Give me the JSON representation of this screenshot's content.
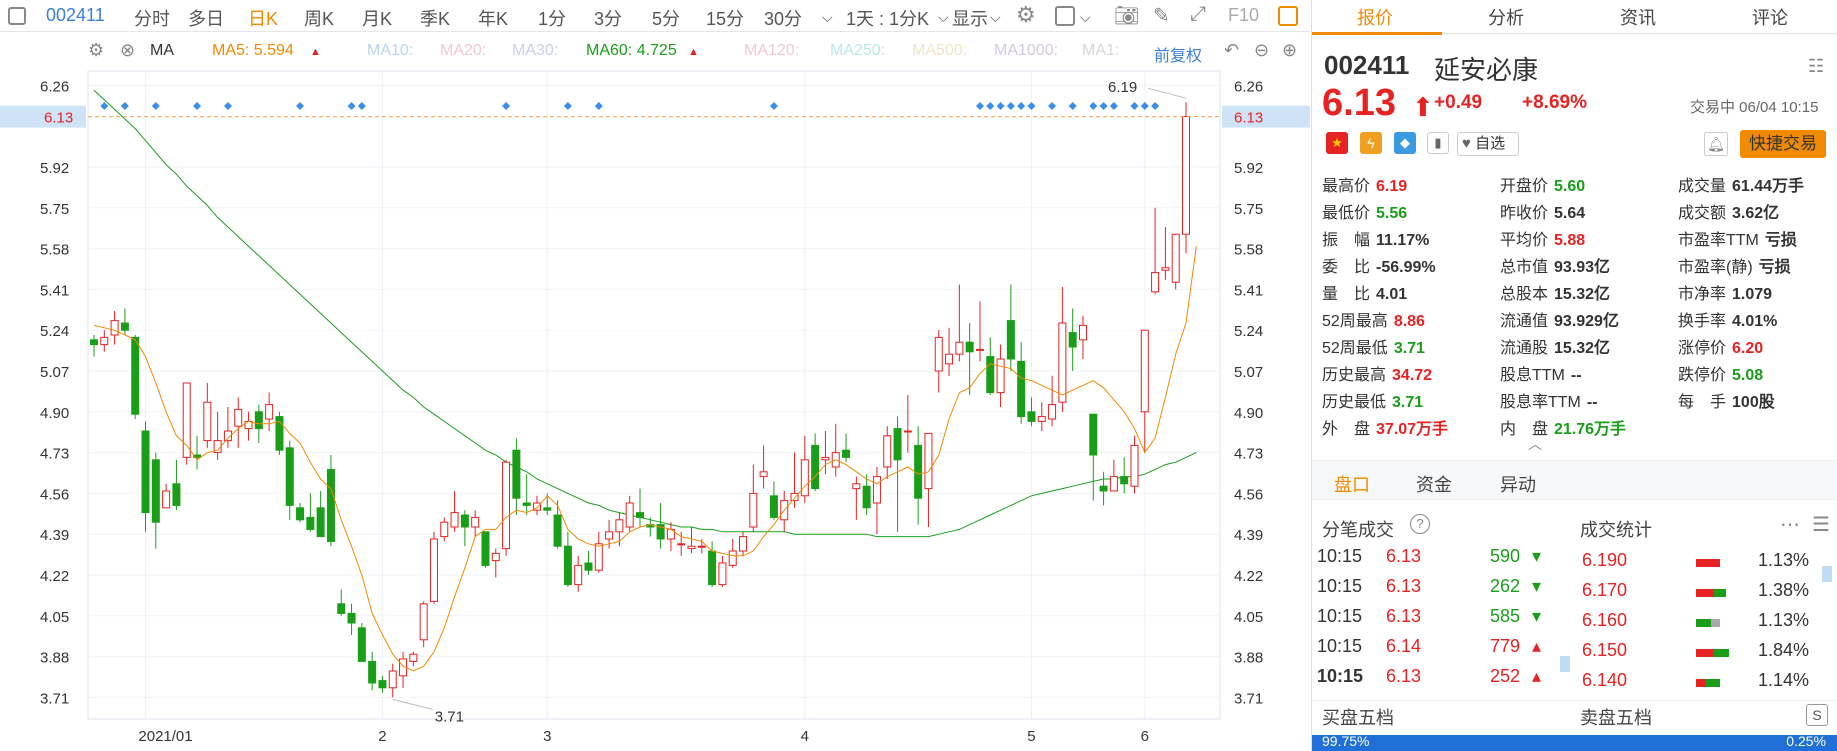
{
  "toolbar": {
    "code": "002411",
    "periods": [
      "分时",
      "多日",
      "日K",
      "周K",
      "月K",
      "季K",
      "年K",
      "1分",
      "3分",
      "5分",
      "15分",
      "30分"
    ],
    "active_period": "日K",
    "interval_select": "1天 : 1分K",
    "display_label": "显示",
    "f10_label": "F10"
  },
  "ma_bar": {
    "type_label": "MA",
    "ma5": "MA5: 5.594",
    "ma10": "MA10:",
    "ma20": "MA20:",
    "ma30": "MA30:",
    "ma60": "MA60: 4.725",
    "ma120": "MA120:",
    "ma250": "MA250:",
    "ma500": "MA500:",
    "ma1000": "MA1000:",
    "ma1": "MA1:",
    "adjust": "前复权"
  },
  "chart_data": {
    "type": "candlestick",
    "ylim": [
      3.62,
      6.32
    ],
    "yticks": [
      3.71,
      3.88,
      4.05,
      4.22,
      4.39,
      4.56,
      4.73,
      4.9,
      5.07,
      5.24,
      5.41,
      5.58,
      5.75,
      5.92,
      6.26
    ],
    "current_price_label": "6.13",
    "current_price": 6.13,
    "high_label": "6.19",
    "low_label": "3.71",
    "xlabels": [
      "2021/01",
      "2",
      "3",
      "4",
      "5",
      "6"
    ],
    "candles": [
      [
        5.2,
        5.22,
        5.13,
        5.18
      ],
      [
        5.18,
        5.24,
        5.15,
        5.21
      ],
      [
        5.22,
        5.32,
        5.18,
        5.28
      ],
      [
        5.27,
        5.33,
        5.22,
        5.24
      ],
      [
        5.21,
        5.22,
        4.87,
        4.89
      ],
      [
        4.82,
        4.86,
        4.4,
        4.48
      ],
      [
        4.7,
        4.73,
        4.33,
        4.44
      ],
      [
        4.5,
        4.6,
        4.5,
        4.57
      ],
      [
        4.6,
        4.7,
        4.49,
        4.51
      ],
      [
        4.71,
        5.02,
        4.68,
        5.02
      ],
      [
        4.72,
        4.8,
        4.66,
        4.71
      ],
      [
        4.78,
        5.02,
        4.75,
        4.94
      ],
      [
        4.73,
        4.9,
        4.7,
        4.78
      ],
      [
        4.78,
        4.92,
        4.75,
        4.82
      ],
      [
        4.84,
        4.96,
        4.75,
        4.91
      ],
      [
        4.83,
        4.9,
        4.78,
        4.86
      ],
      [
        4.9,
        4.93,
        4.77,
        4.83
      ],
      [
        4.87,
        4.98,
        4.82,
        4.93
      ],
      [
        4.88,
        4.9,
        4.72,
        4.74
      ],
      [
        4.75,
        4.78,
        4.45,
        4.51
      ],
      [
        4.5,
        4.52,
        4.44,
        4.45
      ],
      [
        4.46,
        4.56,
        4.4,
        4.41
      ],
      [
        4.5,
        4.57,
        4.38,
        4.38
      ],
      [
        4.66,
        4.72,
        4.34,
        4.36
      ],
      [
        4.1,
        4.16,
        4.05,
        4.06
      ],
      [
        4.06,
        4.1,
        3.97,
        4.02
      ],
      [
        4.0,
        4.02,
        3.86,
        3.86
      ],
      [
        3.86,
        3.9,
        3.74,
        3.77
      ],
      [
        3.78,
        3.8,
        3.73,
        3.75
      ],
      [
        3.75,
        3.85,
        3.71,
        3.82
      ],
      [
        3.8,
        3.9,
        3.75,
        3.87
      ],
      [
        3.86,
        3.9,
        3.84,
        3.89
      ],
      [
        3.95,
        4.11,
        3.92,
        4.1
      ],
      [
        4.11,
        4.4,
        4.1,
        4.37
      ],
      [
        4.38,
        4.46,
        4.36,
        4.44
      ],
      [
        4.42,
        4.57,
        4.4,
        4.48
      ],
      [
        4.47,
        4.49,
        4.34,
        4.42
      ],
      [
        4.42,
        4.49,
        4.38,
        4.46
      ],
      [
        4.4,
        4.4,
        4.25,
        4.26
      ],
      [
        4.28,
        4.33,
        4.21,
        4.31
      ],
      [
        4.33,
        4.7,
        4.3,
        4.69
      ],
      [
        4.74,
        4.79,
        4.47,
        4.54
      ],
      [
        4.52,
        4.64,
        4.47,
        4.51
      ],
      [
        4.49,
        4.55,
        4.47,
        4.52
      ],
      [
        4.5,
        4.56,
        4.47,
        4.49
      ],
      [
        4.47,
        4.53,
        4.33,
        4.34
      ],
      [
        4.34,
        4.4,
        4.17,
        4.18
      ],
      [
        4.18,
        4.3,
        4.15,
        4.26
      ],
      [
        4.27,
        4.32,
        4.22,
        4.24
      ],
      [
        4.24,
        4.4,
        4.23,
        4.35
      ],
      [
        4.37,
        4.45,
        4.33,
        4.4
      ],
      [
        4.4,
        4.48,
        4.34,
        4.45
      ],
      [
        4.42,
        4.55,
        4.4,
        4.52
      ],
      [
        4.48,
        4.58,
        4.42,
        4.46
      ],
      [
        4.43,
        4.46,
        4.38,
        4.42
      ],
      [
        4.43,
        4.52,
        4.33,
        4.37
      ],
      [
        4.37,
        4.44,
        4.32,
        4.41
      ],
      [
        4.35,
        4.4,
        4.3,
        4.35
      ],
      [
        4.33,
        4.42,
        4.31,
        4.34
      ],
      [
        4.34,
        4.37,
        4.31,
        4.34
      ],
      [
        4.32,
        4.36,
        4.17,
        4.18
      ],
      [
        4.18,
        4.3,
        4.17,
        4.27
      ],
      [
        4.26,
        4.37,
        4.25,
        4.32
      ],
      [
        4.32,
        4.4,
        4.3,
        4.38
      ],
      [
        4.42,
        4.68,
        4.4,
        4.56
      ],
      [
        4.63,
        4.76,
        4.58,
        4.65
      ],
      [
        4.55,
        4.61,
        4.45,
        4.46
      ],
      [
        4.45,
        4.57,
        4.4,
        4.53
      ],
      [
        4.53,
        4.73,
        4.5,
        4.56
      ],
      [
        4.55,
        4.8,
        4.52,
        4.7
      ],
      [
        4.76,
        4.81,
        4.57,
        4.58
      ],
      [
        4.7,
        4.82,
        4.64,
        4.71
      ],
      [
        4.67,
        4.85,
        4.63,
        4.73
      ],
      [
        4.74,
        4.81,
        4.69,
        4.71
      ],
      [
        4.58,
        4.63,
        4.45,
        4.6
      ],
      [
        4.59,
        4.64,
        4.47,
        4.5
      ],
      [
        4.52,
        4.67,
        4.39,
        4.63
      ],
      [
        4.67,
        4.84,
        4.62,
        4.8
      ],
      [
        4.83,
        4.88,
        4.4,
        4.7
      ],
      [
        4.82,
        4.97,
        4.73,
        4.82
      ],
      [
        4.76,
        4.84,
        4.43,
        4.54
      ],
      [
        4.58,
        4.81,
        4.42,
        4.81
      ],
      [
        5.07,
        5.24,
        4.98,
        5.21
      ],
      [
        5.1,
        5.25,
        5.05,
        5.14
      ],
      [
        5.14,
        5.43,
        5.11,
        5.19
      ],
      [
        5.19,
        5.27,
        4.97,
        5.15
      ],
      [
        5.16,
        5.36,
        5.11,
        5.16
      ],
      [
        5.13,
        5.21,
        4.97,
        4.98
      ],
      [
        4.98,
        5.18,
        4.92,
        5.12
      ],
      [
        5.28,
        5.43,
        5.07,
        5.12
      ],
      [
        5.11,
        5.19,
        4.85,
        4.88
      ],
      [
        4.9,
        4.96,
        4.84,
        4.86
      ],
      [
        4.86,
        4.94,
        4.82,
        4.88
      ],
      [
        4.87,
        5.05,
        4.84,
        4.93
      ],
      [
        4.94,
        5.42,
        4.9,
        5.27
      ],
      [
        5.23,
        5.33,
        5.07,
        5.17
      ],
      [
        5.2,
        5.3,
        5.12,
        5.26
      ],
      [
        4.89,
        4.89,
        4.53,
        4.72
      ],
      [
        4.59,
        4.65,
        4.51,
        4.57
      ],
      [
        4.57,
        4.7,
        4.57,
        4.63
      ],
      [
        4.63,
        4.71,
        4.56,
        4.6
      ],
      [
        4.59,
        4.8,
        4.56,
        4.76
      ],
      [
        4.9,
        5.24,
        4.73,
        5.24
      ],
      [
        5.4,
        5.75,
        5.39,
        5.48
      ],
      [
        5.49,
        5.67,
        5.45,
        5.5
      ],
      [
        5.44,
        5.64,
        5.41,
        5.64
      ],
      [
        5.64,
        6.19,
        5.56,
        6.13
      ]
    ],
    "ma5": [
      5.26,
      5.25,
      5.24,
      5.22,
      5.2,
      5.13,
      5.02,
      4.9,
      4.8,
      4.76,
      4.7,
      4.73,
      4.74,
      4.79,
      4.83,
      4.86,
      4.85,
      4.85,
      4.86,
      4.81,
      4.77,
      4.69,
      4.62,
      4.58,
      4.45,
      4.34,
      4.22,
      4.06,
      3.97,
      3.89,
      3.84,
      3.82,
      3.84,
      3.9,
      4.0,
      4.13,
      4.25,
      4.38,
      4.41,
      4.41,
      4.46,
      4.49,
      4.48,
      4.5,
      4.55,
      4.51,
      4.41,
      4.37,
      4.35,
      4.34,
      4.35,
      4.36,
      4.4,
      4.42,
      4.43,
      4.42,
      4.41,
      4.38,
      4.37,
      4.36,
      4.32,
      4.31,
      4.3,
      4.3,
      4.32,
      4.38,
      4.43,
      4.49,
      4.54,
      4.59,
      4.63,
      4.68,
      4.7,
      4.68,
      4.65,
      4.62,
      4.6,
      4.63,
      4.65,
      4.67,
      4.64,
      4.65,
      4.72,
      4.87,
      4.98,
      5.0,
      5.06,
      5.1,
      5.09,
      5.08,
      5.04,
      5.03,
      5.01,
      4.99,
      4.97,
      4.99,
      5.01,
      5.03,
      5.0,
      4.95,
      4.9,
      4.83,
      4.73,
      4.79,
      4.96,
      5.14,
      5.27,
      5.59
    ],
    "ma60": [
      6.24,
      6.2,
      6.16,
      6.12,
      6.08,
      6.03,
      5.98,
      5.93,
      5.89,
      5.84,
      5.8,
      5.76,
      5.71,
      5.67,
      5.63,
      5.59,
      5.55,
      5.51,
      5.47,
      5.43,
      5.39,
      5.35,
      5.31,
      5.27,
      5.23,
      5.19,
      5.15,
      5.11,
      5.07,
      5.03,
      4.99,
      4.96,
      4.92,
      4.89,
      4.86,
      4.83,
      4.8,
      4.77,
      4.74,
      4.72,
      4.69,
      4.67,
      4.65,
      4.62,
      4.6,
      4.58,
      4.56,
      4.54,
      4.52,
      4.51,
      4.49,
      4.48,
      4.47,
      4.46,
      4.45,
      4.44,
      4.43,
      4.42,
      4.42,
      4.41,
      4.41,
      4.4,
      4.4,
      4.4,
      4.4,
      4.4,
      4.4,
      4.4,
      4.39,
      4.39,
      4.39,
      4.39,
      4.39,
      4.39,
      4.39,
      4.39,
      4.38,
      4.38,
      4.38,
      4.38,
      4.38,
      4.38,
      4.39,
      4.4,
      4.41,
      4.43,
      4.45,
      4.47,
      4.49,
      4.51,
      4.53,
      4.55,
      4.56,
      4.57,
      4.58,
      4.59,
      4.6,
      4.61,
      4.62,
      4.62,
      4.63,
      4.63,
      4.64,
      4.66,
      4.68,
      4.69,
      4.71,
      4.73
    ],
    "markers_count": 26
  },
  "quote": {
    "code": "002411",
    "name": "延安必康",
    "price": "6.13",
    "change": "+0.49",
    "change_pct": "+8.69%",
    "status": "交易中 06/04 10:15",
    "watch_label": "自选",
    "quick_trade_label": "快捷交易",
    "fields": [
      {
        "label": "最高价",
        "value": "6.19",
        "color": "red"
      },
      {
        "label": "开盘价",
        "value": "5.60",
        "color": "green"
      },
      {
        "label": "成交量",
        "value": "61.44万手",
        "color": "dark"
      },
      {
        "label": "最低价",
        "value": "5.56",
        "color": "green"
      },
      {
        "label": "昨收价",
        "value": "5.64",
        "color": "dark"
      },
      {
        "label": "成交额",
        "value": "3.62亿",
        "color": "dark"
      },
      {
        "label": "振　幅",
        "value": "11.17%",
        "color": "dark"
      },
      {
        "label": "平均价",
        "value": "5.88",
        "color": "red"
      },
      {
        "label": "市盈率TTM",
        "value": "亏损",
        "color": "dark"
      },
      {
        "label": "委　比",
        "value": "-56.99%",
        "color": "dark"
      },
      {
        "label": "总市值",
        "value": "93.93亿",
        "color": "dark"
      },
      {
        "label": "市盈率(静)",
        "value": "亏损",
        "color": "dark"
      },
      {
        "label": "量　比",
        "value": "4.01",
        "color": "dark"
      },
      {
        "label": "总股本",
        "value": "15.32亿",
        "color": "dark"
      },
      {
        "label": "市净率",
        "value": "1.079",
        "color": "dark"
      },
      {
        "label": "52周最高",
        "value": "8.86",
        "color": "red"
      },
      {
        "label": "流通值",
        "value": "93.929亿",
        "color": "dark"
      },
      {
        "label": "换手率",
        "value": "4.01%",
        "color": "dark"
      },
      {
        "label": "52周最低",
        "value": "3.71",
        "color": "green"
      },
      {
        "label": "流通股",
        "value": "15.32亿",
        "color": "dark"
      },
      {
        "label": "涨停价",
        "value": "6.20",
        "color": "red"
      },
      {
        "label": "历史最高",
        "value": "34.72",
        "color": "red"
      },
      {
        "label": "股息TTM",
        "value": "--",
        "color": "dark"
      },
      {
        "label": "跌停价",
        "value": "5.08",
        "color": "green"
      },
      {
        "label": "历史最低",
        "value": "3.71",
        "color": "green"
      },
      {
        "label": "股息率TTM",
        "value": "--",
        "color": "dark"
      },
      {
        "label": "每　手",
        "value": "100股",
        "color": "dark"
      },
      {
        "label": "外　盘",
        "value": "37.07万手",
        "color": "red"
      },
      {
        "label": "内　盘",
        "value": "21.76万手",
        "color": "green"
      }
    ]
  },
  "right_tabs": [
    "报价",
    "分析",
    "资讯",
    "评论"
  ],
  "sub_tabs": [
    "盘口",
    "资金",
    "异动"
  ],
  "ticks_title": "分笔成交",
  "stats_title": "成交统计",
  "ticks": [
    {
      "time": "10:15",
      "price": "6.13",
      "vol": "590",
      "dir": "down"
    },
    {
      "time": "10:15",
      "price": "6.13",
      "vol": "262",
      "dir": "down"
    },
    {
      "time": "10:15",
      "price": "6.13",
      "vol": "585",
      "dir": "down"
    },
    {
      "time": "10:15",
      "price": "6.14",
      "vol": "779",
      "dir": "up"
    },
    {
      "time": "10:15",
      "price": "6.13",
      "vol": "252",
      "dir": "up"
    }
  ],
  "stats": [
    {
      "price": "6.190",
      "pct": "1.13%",
      "red": 0.8,
      "green": 0.0,
      "gray": 0.0
    },
    {
      "price": "6.170",
      "pct": "1.38%",
      "red": 0.6,
      "green": 0.4,
      "gray": 0.0
    },
    {
      "price": "6.160",
      "pct": "1.13%",
      "red": 0.0,
      "green": 0.5,
      "gray": 0.3
    },
    {
      "price": "6.150",
      "pct": "1.84%",
      "red": 0.6,
      "green": 0.5,
      "gray": 0.0
    },
    {
      "price": "6.140",
      "pct": "1.14%",
      "red": 0.3,
      "green": 0.5,
      "gray": 0.0
    }
  ],
  "buy5_label": "买盘五档",
  "sell5_label": "卖盘五档",
  "buy_pct": "99.75%",
  "sell_pct": "0.25%"
}
